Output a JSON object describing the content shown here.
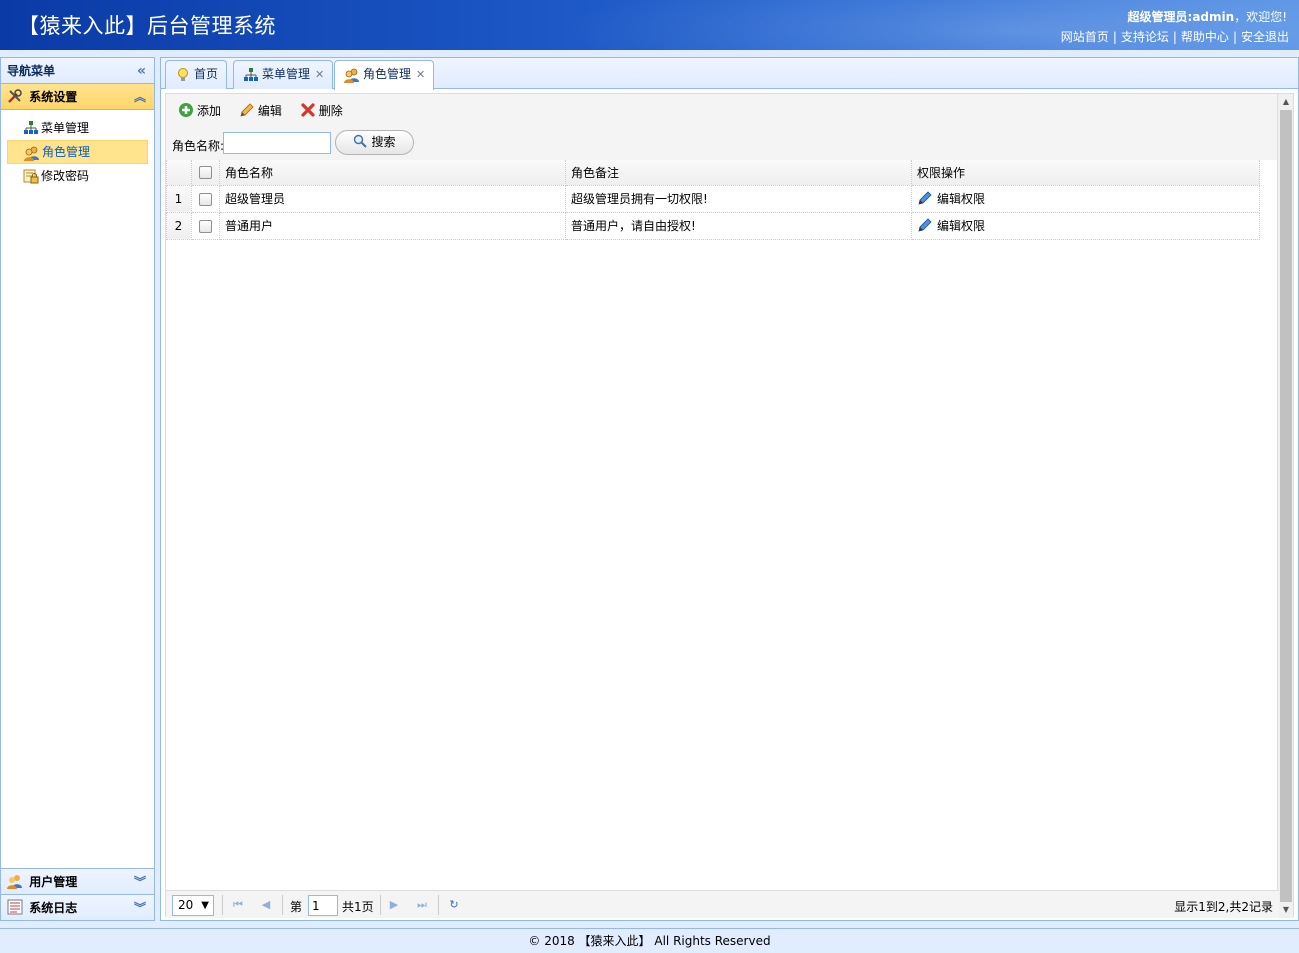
{
  "header": {
    "title": "【猿来入此】后台管理系统",
    "user_label": "超级管理员:admin",
    "welcome": "，欢迎您!",
    "links": [
      "网站首页",
      "支持论坛",
      "帮助中心",
      "安全退出"
    ]
  },
  "nav": {
    "title": "导航菜单",
    "sections": [
      {
        "label": "系统设置",
        "expanded": true,
        "items": [
          {
            "label": "菜单管理",
            "icon": "sitemap-icon"
          },
          {
            "label": "角色管理",
            "icon": "role-users-icon",
            "selected": true
          },
          {
            "label": "修改密码",
            "icon": "password-lock-icon"
          }
        ]
      },
      {
        "label": "用户管理",
        "expanded": false
      },
      {
        "label": "系统日志",
        "expanded": false
      }
    ]
  },
  "tabs": [
    {
      "label": "首页",
      "icon": "lightbulb-icon",
      "closable": false
    },
    {
      "label": "菜单管理",
      "icon": "sitemap-icon",
      "closable": true
    },
    {
      "label": "角色管理",
      "icon": "role-users-icon",
      "closable": true,
      "active": true
    }
  ],
  "toolbar": {
    "add_label": "添加",
    "edit_label": "编辑",
    "delete_label": "删除"
  },
  "search": {
    "label": "角色名称:",
    "value": "",
    "button_label": "搜索"
  },
  "grid": {
    "columns": [
      "角色名称",
      "角色备注",
      "权限操作"
    ],
    "rows": [
      {
        "num": "1",
        "name": "超级管理员",
        "remark": "超级管理员拥有一切权限!",
        "action": "编辑权限"
      },
      {
        "num": "2",
        "name": "普通用户",
        "remark": "普通用户，请自由授权!",
        "action": "编辑权限"
      }
    ]
  },
  "pager": {
    "page_size": "20",
    "page_prefix": "第",
    "page_value": "1",
    "page_total": "共1页",
    "info": "显示1到2,共2记录"
  },
  "footer": {
    "text": "© 2018 【猿来入此】 All Rights Reserved"
  },
  "colors": {
    "header_start": "#0a3aa6",
    "header_end": "#5b95e6",
    "panel_border": "#95b8e7",
    "selected_bg": "#ffe48d"
  }
}
